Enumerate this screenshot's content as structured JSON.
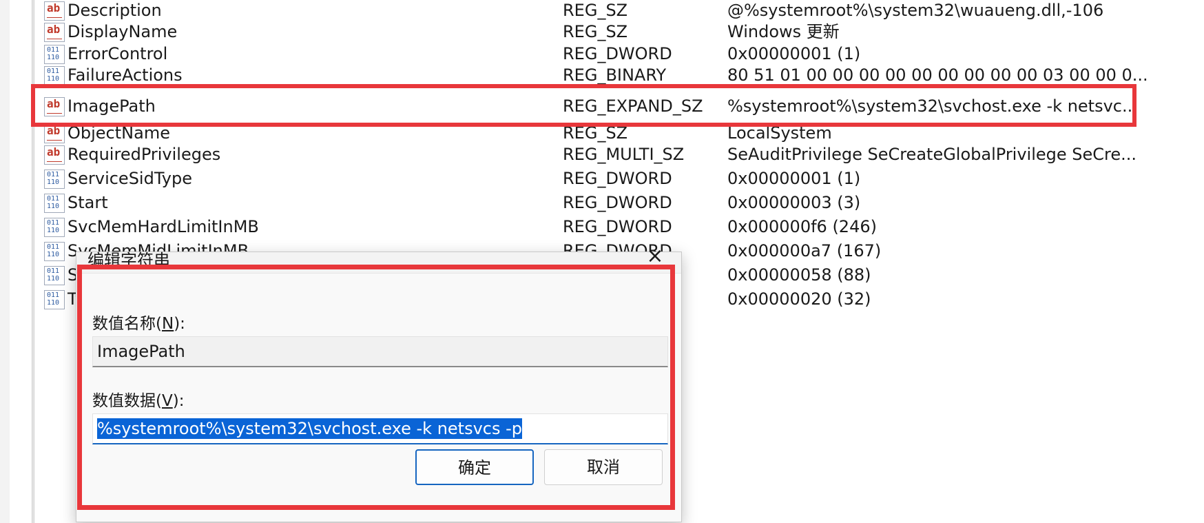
{
  "values": [
    {
      "icon": "string-value-icon",
      "name": "Description",
      "type": "REG_SZ",
      "data": "@%systemroot%\\system32\\wuaueng.dll,-106"
    },
    {
      "icon": "string-value-icon",
      "name": "DisplayName",
      "type": "REG_SZ",
      "data": "Windows 更新"
    },
    {
      "icon": "binary-value-icon",
      "name": "ErrorControl",
      "type": "REG_DWORD",
      "data": "0x00000001 (1)"
    },
    {
      "icon": "binary-value-icon",
      "name": "FailureActions",
      "type": "REG_BINARY",
      "data": "80 51 01 00 00 00 00 00 00 00 00 00 03 00 00 0..."
    },
    {
      "icon": "string-value-icon",
      "name": "ImagePath",
      "type": "REG_EXPAND_SZ",
      "data": "%systemroot%\\system32\\svchost.exe -k netsvc..."
    },
    {
      "icon": "string-value-icon",
      "name": "ObjectName",
      "type": "REG_SZ",
      "data": "LocalSystem"
    },
    {
      "icon": "string-value-icon",
      "name": "RequiredPrivileges",
      "type": "REG_MULTI_SZ",
      "data": "SeAuditPrivilege SeCreateGlobalPrivilege SeCre..."
    },
    {
      "icon": "binary-value-icon",
      "name": "ServiceSidType",
      "type": "REG_DWORD",
      "data": "0x00000001 (1)"
    },
    {
      "icon": "binary-value-icon",
      "name": "Start",
      "type": "REG_DWORD",
      "data": "0x00000003 (3)"
    },
    {
      "icon": "binary-value-icon",
      "name": "SvcMemHardLimitInMB",
      "type": "REG_DWORD",
      "data": "0x000000f6 (246)"
    },
    {
      "icon": "binary-value-icon",
      "name": "SvcMemMidLimitInMB",
      "type": "REG_DWORD",
      "data": "0x000000a7 (167)"
    },
    {
      "icon": "binary-value-icon",
      "name": "Sv",
      "type": "",
      "data": "0x00000058 (88)"
    },
    {
      "icon": "binary-value-icon",
      "name": "Ty",
      "type": "",
      "data": "0x00000020 (32)"
    }
  ],
  "dialog": {
    "title": "编辑字符串",
    "close_icon": "×",
    "name_label_prefix": "数值名称(",
    "name_label_key": "N",
    "name_label_suffix": "):",
    "name_value": "ImagePath",
    "data_label_prefix": "数值数据(",
    "data_label_key": "V",
    "data_label_suffix": "):",
    "data_value": "%systemroot%\\system32\\svchost.exe -k netsvcs -p",
    "ok_label": "确定",
    "cancel_label": "取消"
  },
  "colors": {
    "highlight": "#e8373b",
    "selection": "#0a64d6",
    "focus_border": "#1565c0"
  }
}
